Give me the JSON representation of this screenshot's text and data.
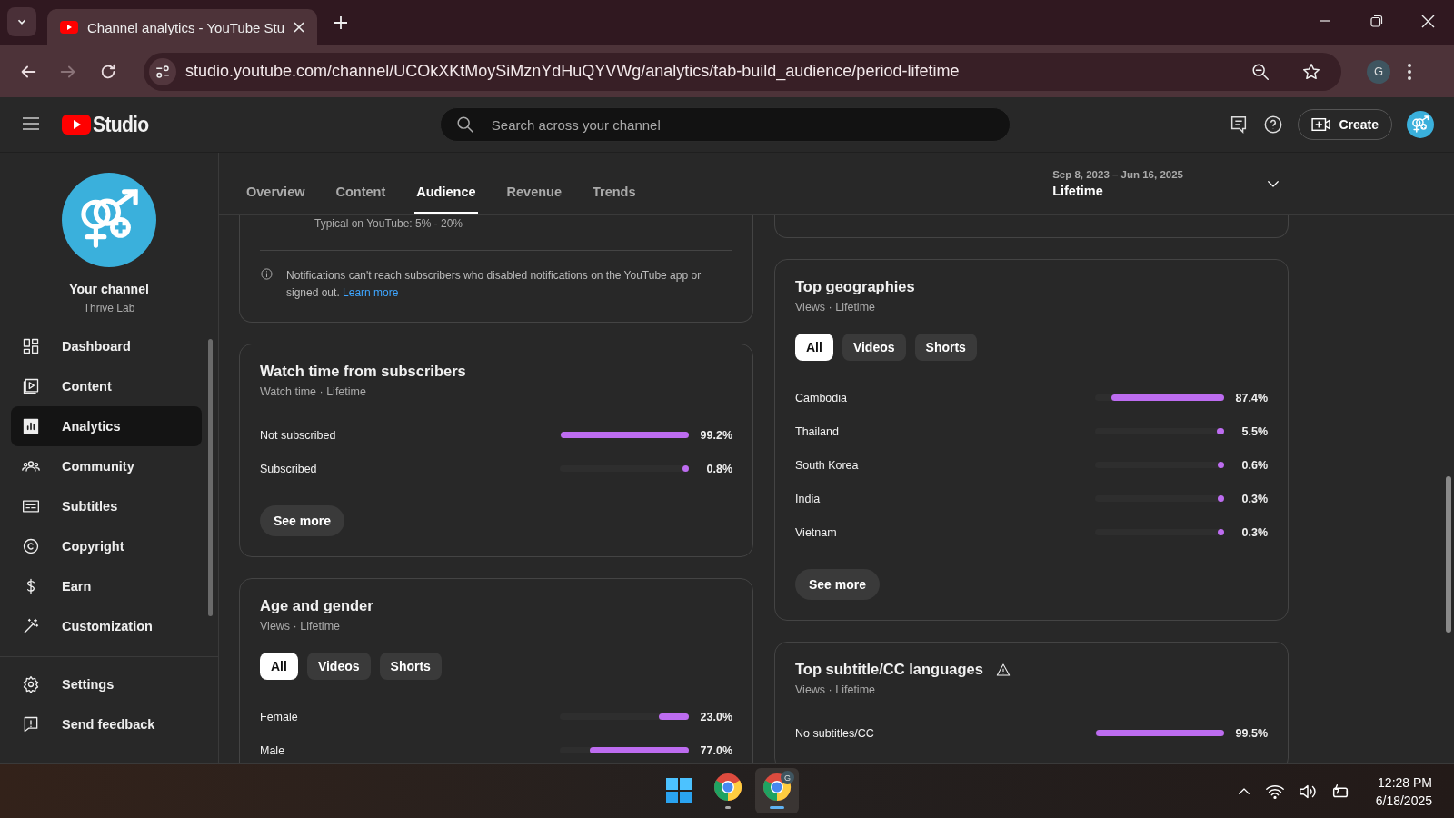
{
  "browser": {
    "tabs": [
      {
        "title": "Channel analytics - YouTube Stu",
        "selected": true
      }
    ],
    "nav_buttons": [
      {
        "kind": "back",
        "disabled": false
      },
      {
        "kind": "forward",
        "disabled": true
      },
      {
        "kind": "reload",
        "disabled": false
      }
    ],
    "address": "studio.youtube.com/channel/UCOkXKtMoySiMznYdHuQYVWg/analytics/tab-build_audience/period-lifetime",
    "profile": "G"
  },
  "header": {
    "logo": "Studio",
    "search": {
      "placeholder": "Search across your channel"
    },
    "create": "Create"
  },
  "sidebar": {
    "channel_title": "Your channel",
    "channel_name": "Thrive Lab",
    "items": [
      {
        "kind": "dashboard",
        "label": "Dashboard",
        "selected": false
      },
      {
        "kind": "content",
        "label": "Content",
        "selected": false
      },
      {
        "kind": "analytics",
        "label": "Analytics",
        "selected": true
      },
      {
        "kind": "community",
        "label": "Community",
        "selected": false
      },
      {
        "kind": "subtitles",
        "label": "Subtitles",
        "selected": false
      },
      {
        "kind": "copyright",
        "label": "Copyright",
        "selected": false
      },
      {
        "kind": "earn",
        "label": "Earn",
        "selected": false
      },
      {
        "kind": "customization",
        "label": "Customization",
        "selected": false
      }
    ],
    "footer_items": [
      {
        "kind": "settings",
        "label": "Settings"
      },
      {
        "kind": "feedback",
        "label": "Send feedback"
      }
    ]
  },
  "analytics": {
    "tabs": [
      {
        "label": "Overview",
        "selected": false
      },
      {
        "label": "Content",
        "selected": false
      },
      {
        "label": "Audience",
        "selected": true
      },
      {
        "label": "Revenue",
        "selected": false
      },
      {
        "label": "Trends",
        "selected": false
      }
    ],
    "date_range": "Sep 8, 2023 – Jun 16, 2025",
    "period": "Lifetime"
  },
  "left_column": [
    {
      "kind": "note",
      "typical": "Typical on YouTube: 5% - 20%",
      "note": "Notifications can't reach subscribers who disabled notifications on the YouTube app or signed out.",
      "link": "Learn more"
    },
    {
      "kind": "bars",
      "title": "Watch time from subscribers",
      "subtitle": "Watch time · Lifetime",
      "rows": [
        {
          "label": "Not subscribed",
          "level": 0.992,
          "value": "99.2%"
        },
        {
          "label": "Subscribed",
          "level": 0.008,
          "value": "0.8%"
        }
      ],
      "button": "See more"
    },
    {
      "kind": "bars",
      "title": "Age and gender",
      "subtitle": "Views · Lifetime",
      "filters": [
        {
          "label": "All",
          "selected": true
        },
        {
          "label": "Videos",
          "selected": false
        },
        {
          "label": "Shorts",
          "selected": false
        }
      ],
      "rows": [
        {
          "label": "Female",
          "level": 0.23,
          "value": "23.0%"
        },
        {
          "label": "Male",
          "level": 0.77,
          "value": "77.0%"
        }
      ]
    }
  ],
  "right_column": [
    {
      "kind": "stub"
    },
    {
      "kind": "bars",
      "title": "Top geographies",
      "subtitle": "Views · Lifetime",
      "filters": [
        {
          "label": "All",
          "selected": true
        },
        {
          "label": "Videos",
          "selected": false
        },
        {
          "label": "Shorts",
          "selected": false
        }
      ],
      "rows": [
        {
          "label": "Cambodia",
          "level": 0.874,
          "value": "87.4%"
        },
        {
          "label": "Thailand",
          "level": 0.055,
          "value": "5.5%"
        },
        {
          "label": "South Korea",
          "level": 0.006,
          "value": "0.6%"
        },
        {
          "label": "India",
          "level": 0.003,
          "value": "0.3%"
        },
        {
          "label": "Vietnam",
          "level": 0.003,
          "value": "0.3%"
        }
      ],
      "button": "See more"
    },
    {
      "kind": "bars",
      "title": "Top subtitle/CC languages",
      "warning": true,
      "subtitle": "Views · Lifetime",
      "rows": [
        {
          "label": "No subtitles/CC",
          "level": 0.995,
          "value": "99.5%"
        }
      ]
    }
  ],
  "taskbar": {
    "apps": [
      {
        "kind": "start",
        "active": false
      },
      {
        "kind": "chrome",
        "active": false
      },
      {
        "kind": "chrome",
        "badge": "G",
        "active": true
      }
    ],
    "time": "12:28 PM",
    "date": "6/18/2025"
  }
}
